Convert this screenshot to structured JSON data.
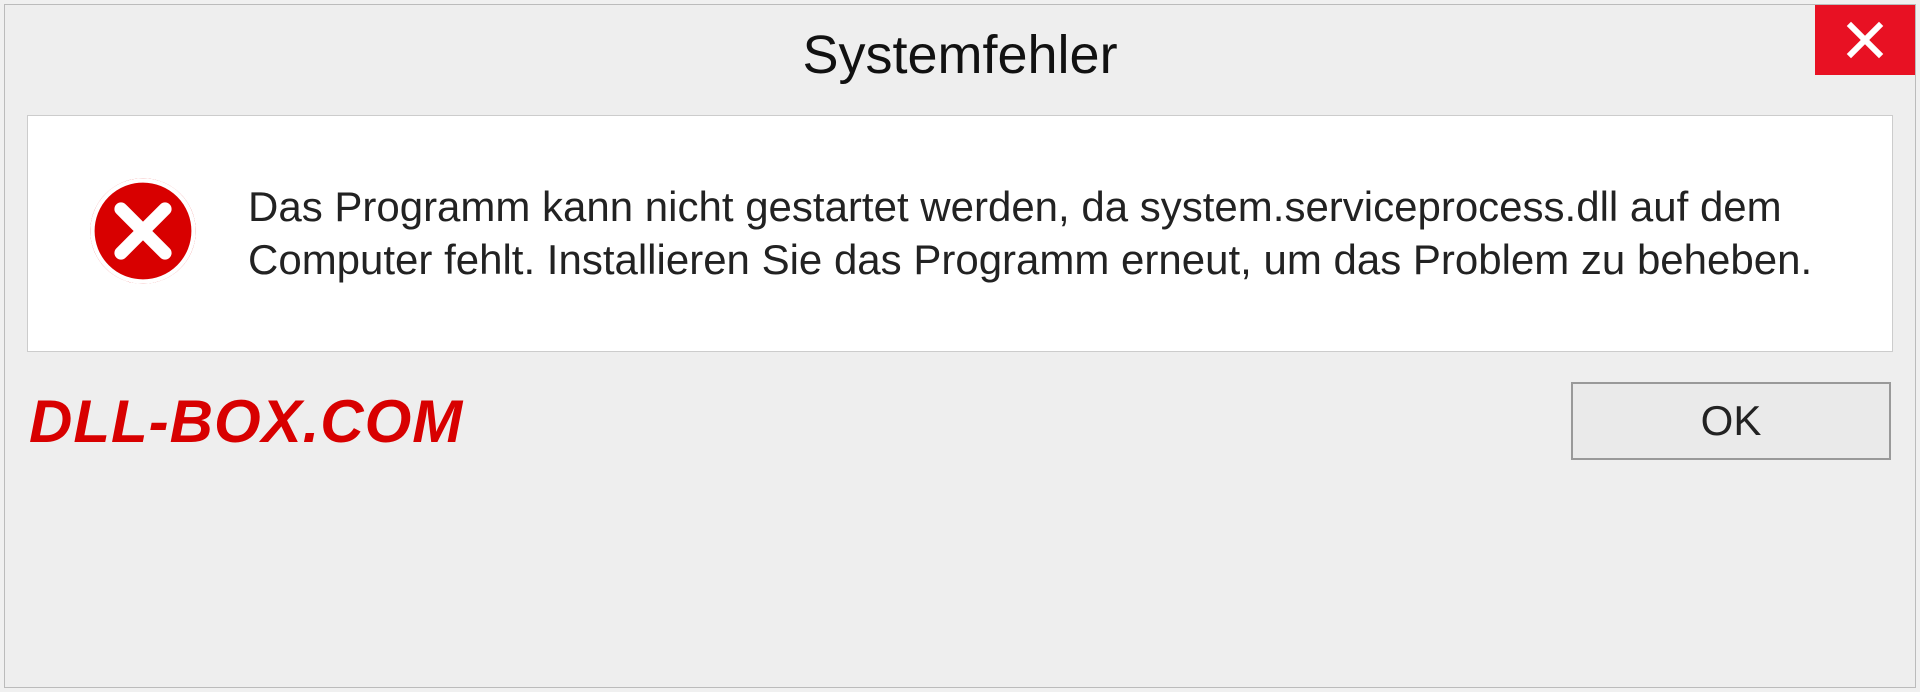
{
  "dialog": {
    "title": "Systemfehler",
    "message": "Das Programm kann nicht gestartet werden, da system.serviceprocess.dll auf dem Computer fehlt. Installieren Sie das Programm erneut, um das Problem zu beheben.",
    "ok_label": "OK"
  },
  "watermark": "DLL-BOX.COM"
}
